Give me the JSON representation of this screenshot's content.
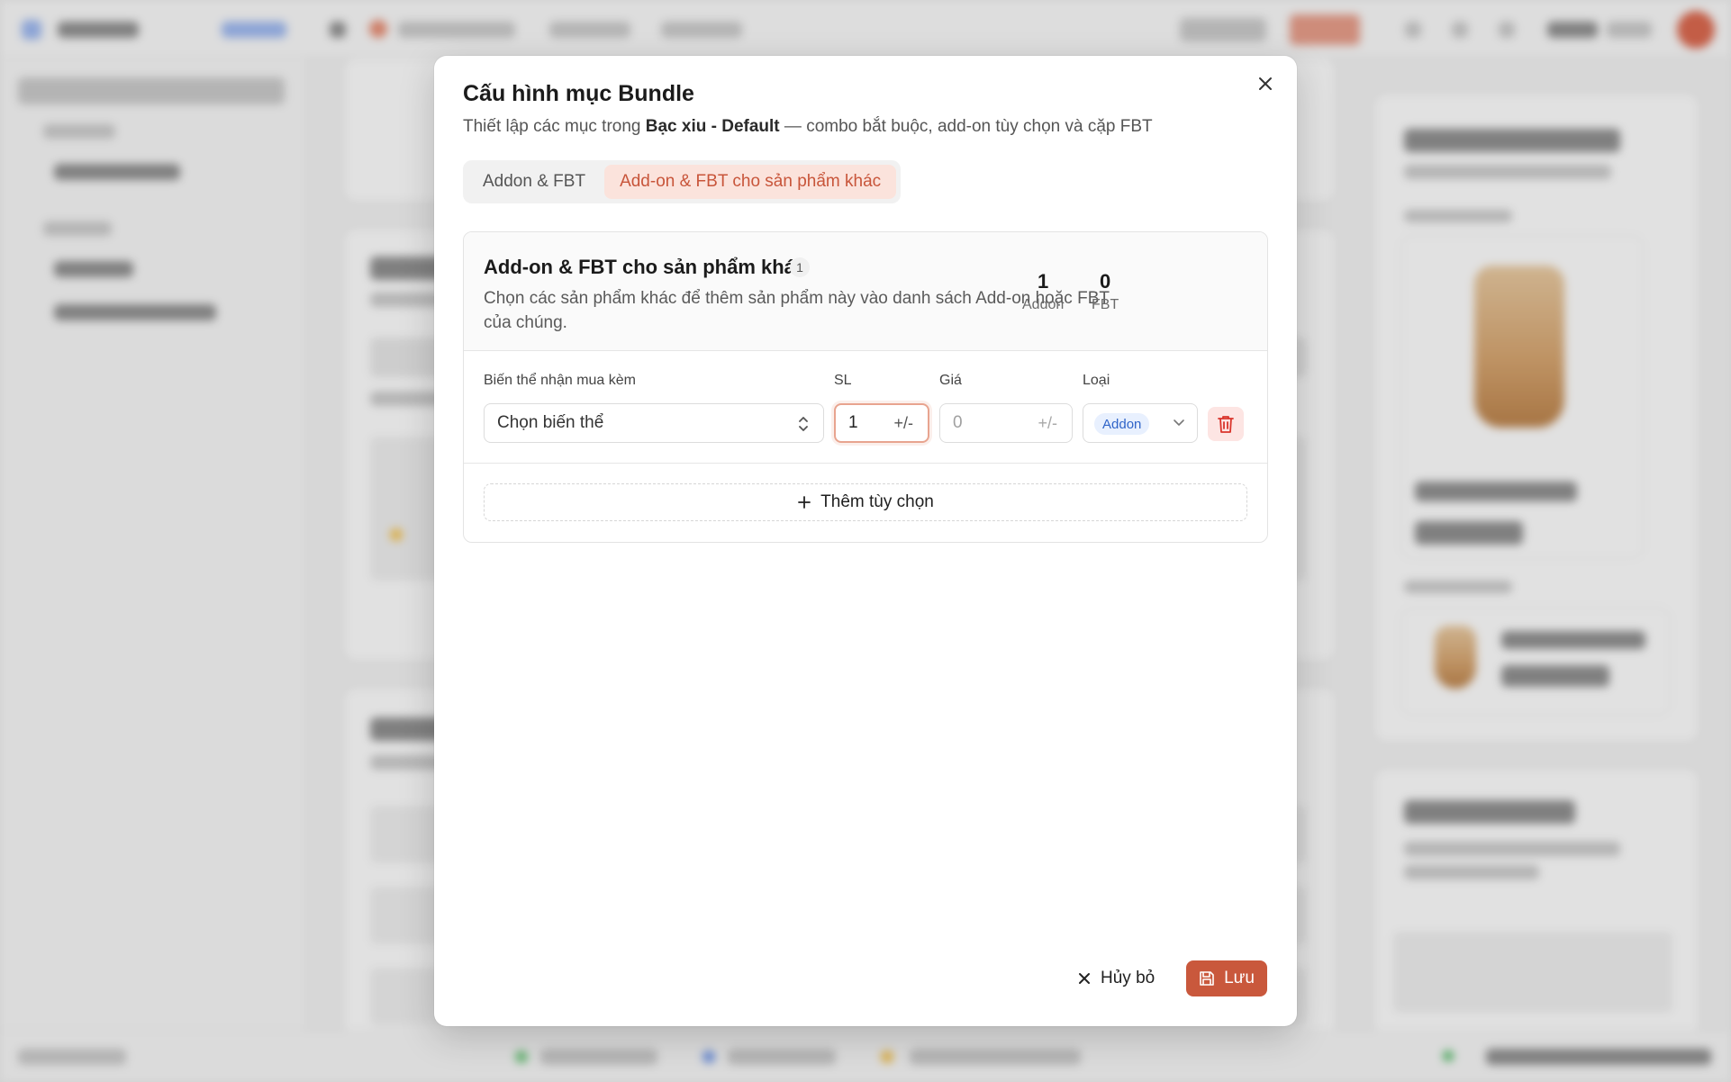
{
  "dialog": {
    "title": "Cấu hình mục Bundle",
    "subtitle_prefix": "Thiết lập các mục trong",
    "subtitle_item": "Bạc xiu - Default",
    "subtitle_suffix": "— combo bắt buộc, add-on tùy chọn và cặp FBT",
    "close_icon": "close-icon"
  },
  "tabs": [
    {
      "label": "Addon & FBT",
      "active": false
    },
    {
      "label": "Add-on & FBT cho sản phẩm khác",
      "active": true
    }
  ],
  "section": {
    "title": "Add-on & FBT cho sản phẩm khác",
    "count": "1",
    "description": "Chọn các sản phẩm khác để thêm sản phẩm này vào danh sách Add-on hoặc FBT của chúng.",
    "stats": [
      {
        "value": "1",
        "label": "Addon"
      },
      {
        "value": "0",
        "label": "FBT"
      }
    ]
  },
  "row": {
    "labels": {
      "variant": "Biến thể nhận mua kèm",
      "qty": "SL",
      "price": "Giá",
      "type": "Loại"
    },
    "variant_placeholder": "Chọn biến thể",
    "qty_value": "1",
    "qty_adjust": "+/-",
    "price_value": "0",
    "price_adjust": "+/-",
    "type_value": "Addon"
  },
  "add_option_label": "Thêm tùy chọn",
  "footer": {
    "cancel_label": "Hủy bỏ",
    "save_label": "Lưu"
  },
  "colors": {
    "accent": "#c9583c",
    "tab_active_bg": "#fbe3dc",
    "addon_pill_bg": "#e8f0fe",
    "addon_pill_text": "#2f64c8",
    "delete_bg": "#fde5e3",
    "delete_icon": "#d9342b"
  }
}
